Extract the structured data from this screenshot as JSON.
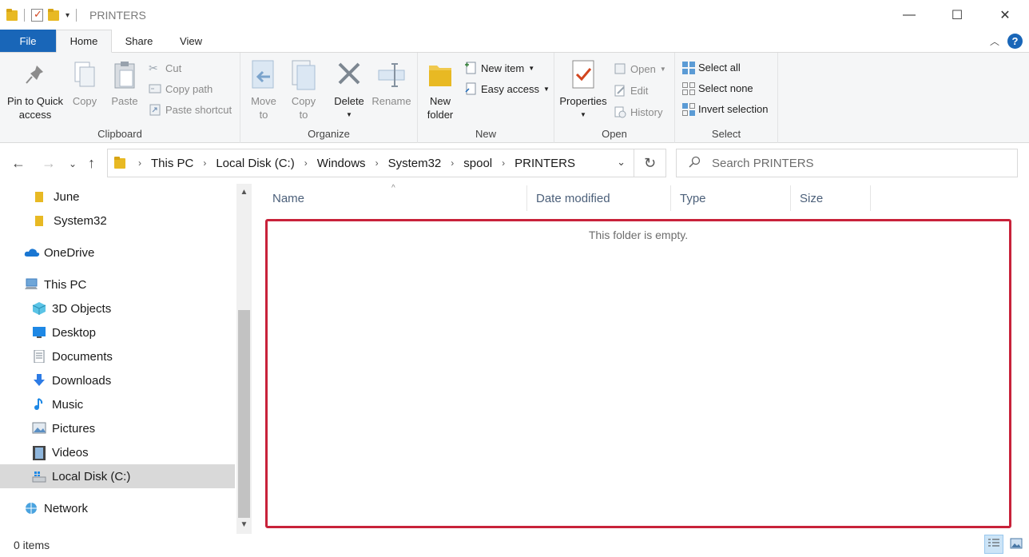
{
  "window": {
    "title": "PRINTERS",
    "controls": {
      "minimize": "—",
      "maximize": "☐",
      "close": "✕"
    }
  },
  "ribbon_tabs": [
    {
      "label": "File"
    },
    {
      "label": "Home"
    },
    {
      "label": "Share"
    },
    {
      "label": "View"
    }
  ],
  "ribbon": {
    "clipboard": {
      "label": "Clipboard",
      "pin": "Pin to Quick\naccess",
      "copy": "Copy",
      "paste": "Paste",
      "cut": "Cut",
      "copy_path": "Copy path",
      "paste_shortcut": "Paste shortcut"
    },
    "organize": {
      "label": "Organize",
      "move_to": "Move\nto",
      "copy_to": "Copy\nto",
      "delete": "Delete",
      "rename": "Rename"
    },
    "new": {
      "label": "New",
      "new_folder": "New\nfolder",
      "new_item": "New item",
      "easy_access": "Easy access"
    },
    "open": {
      "label": "Open",
      "properties": "Properties",
      "open": "Open",
      "edit": "Edit",
      "history": "History"
    },
    "select": {
      "label": "Select",
      "select_all": "Select all",
      "select_none": "Select none",
      "invert": "Invert selection"
    }
  },
  "address": {
    "breadcrumbs": [
      "This PC",
      "Local Disk (C:)",
      "Windows",
      "System32",
      "spool",
      "PRINTERS"
    ]
  },
  "search": {
    "placeholder": "Search PRINTERS"
  },
  "nav_pane": {
    "items": [
      {
        "label": "June",
        "icon": "folder-icon"
      },
      {
        "label": "System32",
        "icon": "folder-icon"
      },
      {
        "label": "OneDrive",
        "icon": "onedrive-icon"
      },
      {
        "label": "This PC",
        "icon": "this-pc-icon"
      },
      {
        "label": "3D Objects",
        "icon": "3d-objects-icon"
      },
      {
        "label": "Desktop",
        "icon": "desktop-icon"
      },
      {
        "label": "Documents",
        "icon": "documents-icon"
      },
      {
        "label": "Downloads",
        "icon": "downloads-icon"
      },
      {
        "label": "Music",
        "icon": "music-icon"
      },
      {
        "label": "Pictures",
        "icon": "pictures-icon"
      },
      {
        "label": "Videos",
        "icon": "videos-icon"
      },
      {
        "label": "Local Disk (C:)",
        "icon": "local-disk-icon",
        "selected": true
      },
      {
        "label": "Network",
        "icon": "network-icon"
      }
    ]
  },
  "columns": [
    "Name",
    "Date modified",
    "Type",
    "Size"
  ],
  "content": {
    "empty_message": "This folder is empty."
  },
  "status": {
    "item_count": "0 items"
  },
  "colors": {
    "accent": "#1966b8",
    "highlight_border": "#c8223a",
    "folder": "#e8b923"
  }
}
